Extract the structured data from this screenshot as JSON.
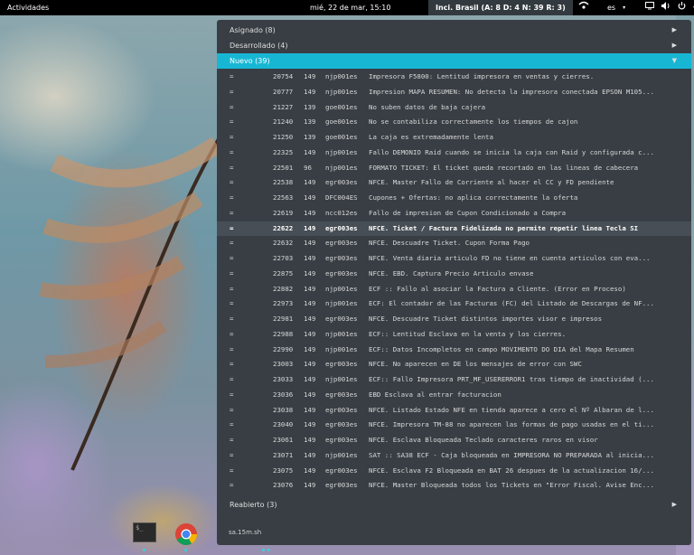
{
  "topbar": {
    "activities": "Actividades",
    "clock": "mié, 22 de mar, 15:10",
    "indicator": "Inci. Brasil (A: 8 D: 4 N: 39 R: 3)",
    "language": "es",
    "icons": [
      "network-icon",
      "screen-icon",
      "volume-icon",
      "power-icon"
    ]
  },
  "sections": {
    "asignado": "Asignado (8)",
    "desarrollado": "Desarrollado (4)",
    "nuevo": "Nuevo (39)",
    "reabierto": "Reabierto (3)"
  },
  "issues": [
    {
      "eq": "=",
      "id": "20754",
      "prio": "149",
      "user": "njp001es",
      "desc": "Impresora F5800: Lentitud impresora en ventas y cierres."
    },
    {
      "eq": "=",
      "id": "20777",
      "prio": "149",
      "user": "njp001es",
      "desc": "Impresion MAPA RESUMEN: No detecta la impresora conectada EPSON M105..."
    },
    {
      "eq": "=",
      "id": "21227",
      "prio": "139",
      "user": "goe001es",
      "desc": "No suben datos de baja cajera"
    },
    {
      "eq": "=",
      "id": "21240",
      "prio": "139",
      "user": "goe001es",
      "desc": "No se contabiliza correctamente los tiempos de cajon"
    },
    {
      "eq": "=",
      "id": "21250",
      "prio": "139",
      "user": "goe001es",
      "desc": "La caja es extremadamente lenta"
    },
    {
      "eq": "=",
      "id": "22325",
      "prio": "149",
      "user": "njp001es",
      "desc": "Fallo DEMONIO Raid cuando se inicia la caja con Raid y configurada c..."
    },
    {
      "eq": "=",
      "id": "22501",
      "prio": "96",
      "user": "njp001es",
      "desc": "FORMATO TICKET: El ticket queda recortado en las lineas de cabecera"
    },
    {
      "eq": "=",
      "id": "22538",
      "prio": "149",
      "user": "egr003es",
      "desc": "NFCE. Master Fallo de Corriente al hacer el CC y FD pendiente"
    },
    {
      "eq": "=",
      "id": "22563",
      "prio": "149",
      "user": "DFC004ES",
      "desc": "Cupones + Ofertas: no aplica correctamente la oferta"
    },
    {
      "eq": "=",
      "id": "22619",
      "prio": "149",
      "user": "ncc012es",
      "desc": "Fallo de impresion de Cupon Condicionado a Compra"
    },
    {
      "eq": "=",
      "id": "22622",
      "prio": "149",
      "user": "egr003es",
      "desc": "NFCE. Ticket / Factura Fidelizada no permite repetir linea Tecla SI",
      "selected": true
    },
    {
      "eq": "=",
      "id": "22632",
      "prio": "149",
      "user": "egr003es",
      "desc": "NFCE. Descuadre Ticket. Cupon Forma Pago"
    },
    {
      "eq": "=",
      "id": "22703",
      "prio": "149",
      "user": "egr003es",
      "desc": "NFCE. Venta diaria articulo FD no tiene en cuenta articulos con eva..."
    },
    {
      "eq": "=",
      "id": "22875",
      "prio": "149",
      "user": "egr003es",
      "desc": "NFCE. EBD. Captura Precio Articulo envase"
    },
    {
      "eq": "=",
      "id": "22882",
      "prio": "149",
      "user": "njp001es",
      "desc": "ECF :: Fallo al asociar la Factura a Cliente. (Error en Proceso)"
    },
    {
      "eq": "=",
      "id": "22973",
      "prio": "149",
      "user": "njp001es",
      "desc": "ECF: El contador de las Facturas (FC) del Listado de Descargas de NF..."
    },
    {
      "eq": "=",
      "id": "22981",
      "prio": "149",
      "user": "egr003es",
      "desc": "NFCE. Descuadre Ticket distintos importes visor e impresos"
    },
    {
      "eq": "=",
      "id": "22988",
      "prio": "149",
      "user": "njp001es",
      "desc": "ECF:: Lentitud Esclava en la venta y los cierres."
    },
    {
      "eq": "=",
      "id": "22990",
      "prio": "149",
      "user": "njp001es",
      "desc": "ECF:: Datos Incompletos en campo MOVIMENTO DO DIA del Mapa Resumen"
    },
    {
      "eq": "=",
      "id": "23003",
      "prio": "149",
      "user": "egr003es",
      "desc": "NFCE. No aparecen en DE los mensajes de error con SWC"
    },
    {
      "eq": "=",
      "id": "23033",
      "prio": "149",
      "user": "njp001es",
      "desc": "ECF:: Fallo Impresora PRT_MF_USERERROR1 tras tiempo de inactividad (..."
    },
    {
      "eq": "=",
      "id": "23036",
      "prio": "149",
      "user": "egr003es",
      "desc": "EBD Esclava al entrar facturacion"
    },
    {
      "eq": "=",
      "id": "23038",
      "prio": "149",
      "user": "egr003es",
      "desc": "NFCE. Listado Estado NFE en tienda aparece a cero el Nº Albaran de l..."
    },
    {
      "eq": "=",
      "id": "23040",
      "prio": "149",
      "user": "egr003es",
      "desc": "NFCE. Impresora TM-88 no aparecen las formas de pago usadas en el ti..."
    },
    {
      "eq": "=",
      "id": "23061",
      "prio": "149",
      "user": "egr003es",
      "desc": "NFCE. Esclava  Bloqueada Teclado caracteres raros en visor"
    },
    {
      "eq": "=",
      "id": "23071",
      "prio": "149",
      "user": "njp001es",
      "desc": "SAT :: SA38 ECF - Caja bloqueada en IMPRESORA NO PREPARADA al inicia..."
    },
    {
      "eq": "=",
      "id": "23075",
      "prio": "149",
      "user": "egr003es",
      "desc": "NFCE. Esclava F2 Bloqueada en BAT 26 despues de la actualizacion 16/..."
    },
    {
      "eq": "=",
      "id": "23076",
      "prio": "149",
      "user": "egr003es",
      "desc": "NFCE. Master Bloqueada todos los Tickets en \"Error Fiscal. Avise Enc..."
    }
  ],
  "footer": {
    "label": "sa.15m.sh"
  },
  "dock": {
    "terminal_text": "$_"
  },
  "colors": {
    "accent": "#17b7d4",
    "panel": "#383e44",
    "selected_row": "#474e55"
  }
}
